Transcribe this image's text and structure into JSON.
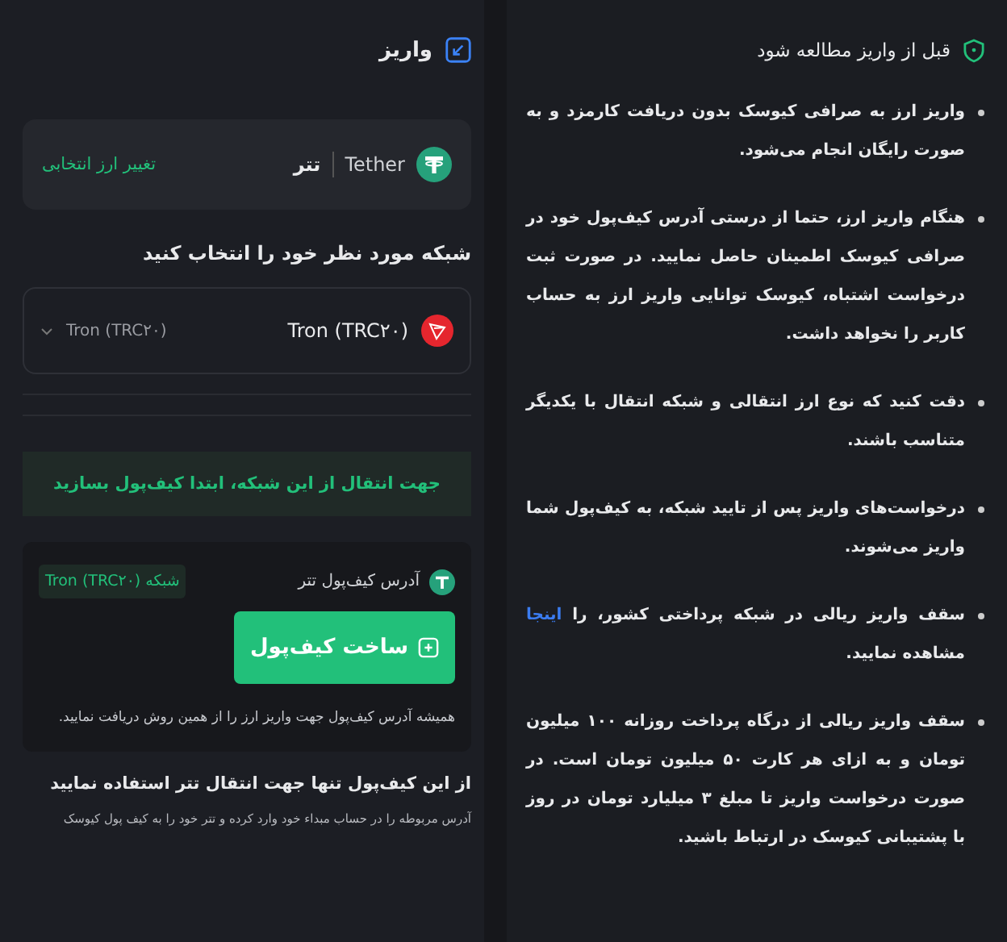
{
  "deposit": {
    "title": "واریز",
    "currency": {
      "name": "تتر",
      "symbol": "Tether",
      "change_link": "تغییر ارز انتخابی"
    },
    "network_prompt": "شبکه مورد نظر خود را انتخاب کنید",
    "network_select": {
      "name": "Tron (TRC۲۰)",
      "value": "Tron (TRC۲۰)"
    },
    "banner": "جهت انتقال از این شبکه، ابتدا کیف‌پول بسازید",
    "wallet": {
      "label": "آدرس کیف‌پول تتر",
      "network_tag": "شبکه Tron (TRC۲۰)",
      "button": "ساخت کیف‌پول",
      "note": "همیشه آدرس کیف‌پول جهت واریز ارز را از همین روش دریافت نمایید."
    },
    "warning_title": "از این کیف‌پول تنها جهت انتقال تتر استفاده نمایید",
    "warning_text": "آدرس مربوطه را در حساب مبداء خود وارد کرده و تتر خود را به کیف پول کیوسک"
  },
  "notes": {
    "title": "قبل از واریز مطالعه شود",
    "bullets": [
      {
        "kind": "text",
        "text": "واریز ارز به صرافی کیوسک بدون دریافت کارمزد و به صورت رایگان انجام می‌شود."
      },
      {
        "kind": "text",
        "text": "هنگام واریز ارز، حتما از درستی آدرس کیف‌پول خود در صرافی کیوسک اطمینان حاصل نمایید. در صورت ثبت درخواست اشتباه، کیوسک توانایی واریز ارز به حساب کاربر را نخواهد داشت."
      },
      {
        "kind": "text",
        "text": "دقت کنید که نوع ارز انتقالی و شبکه انتقال با یکدیگر متناسب باشند."
      },
      {
        "kind": "text",
        "text": "درخواست‌های واریز پس از تایید شبکه، به کیف‌پول شما واریز می‌شوند."
      },
      {
        "kind": "link",
        "before": "سقف واریز ریالی در شبکه پرداختی کشور، را",
        "link": "اینجا",
        "after": "مشاهده نمایید."
      },
      {
        "kind": "text",
        "text": "سقف واریز ریالی از درگاه پرداخت روزانه ۱۰۰ میلیون تومان و به ازای هر کارت ۵۰ میلیون تومان است. در صورت درخواست واریز تا مبلغ ۳ میلیارد تومان در روز با پشتیبانی کیوسک در ارتباط باشید."
      }
    ]
  }
}
